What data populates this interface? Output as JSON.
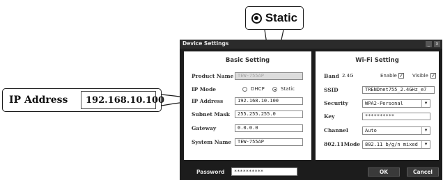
{
  "callouts": {
    "static_label": "Static",
    "ip_label": "IP Address",
    "ip_value": "192.168.10.100"
  },
  "window": {
    "title": "Device Settings",
    "minimize_glyph": "_",
    "close_glyph": "x"
  },
  "basic_setting": {
    "title": "Basic Setting",
    "product_name_label": "Product Name",
    "product_name_value": "TEW-755AP",
    "ip_mode_label": "IP Mode",
    "ip_mode_dhcp": "DHCP",
    "ip_mode_static": "Static",
    "ip_mode_selected": "Static",
    "ip_address_label": "IP Address",
    "ip_address_value": "192.168.10.100",
    "subnet_label": "Subnet Mask",
    "subnet_value": "255.255.255.0",
    "gateway_label": "Gateway",
    "gateway_value": "0.0.0.0",
    "system_name_label": "System Name",
    "system_name_value": "TEW-755AP"
  },
  "wifi_setting": {
    "title": "Wi-Fi Setting",
    "band_label": "Band",
    "band_value": "2.4G",
    "enable_label": "Enable",
    "enable_checked": true,
    "visible_label": "Visible",
    "visible_checked": true,
    "ssid_label": "SSID",
    "ssid_value": "TRENDnet755_2.4GHz_e7",
    "security_label": "Security",
    "security_value": "WPA2-Personal",
    "key_label": "Key",
    "key_value": "**********",
    "channel_label": "Channel",
    "channel_value": "Auto",
    "mode_label": "802.11Mode",
    "mode_value": "802.11 b/g/n mixed"
  },
  "footer": {
    "password_label": "Password",
    "password_value": "**********",
    "ok_label": "OK",
    "cancel_label": "Cancel"
  },
  "icons": {
    "dropdown_arrow": "▼",
    "check_mark": "✓"
  },
  "colors": {
    "window_bg": "#1c1c1c",
    "panel_bg": "#ffffff",
    "disabled_field": "#dcdcdc"
  }
}
